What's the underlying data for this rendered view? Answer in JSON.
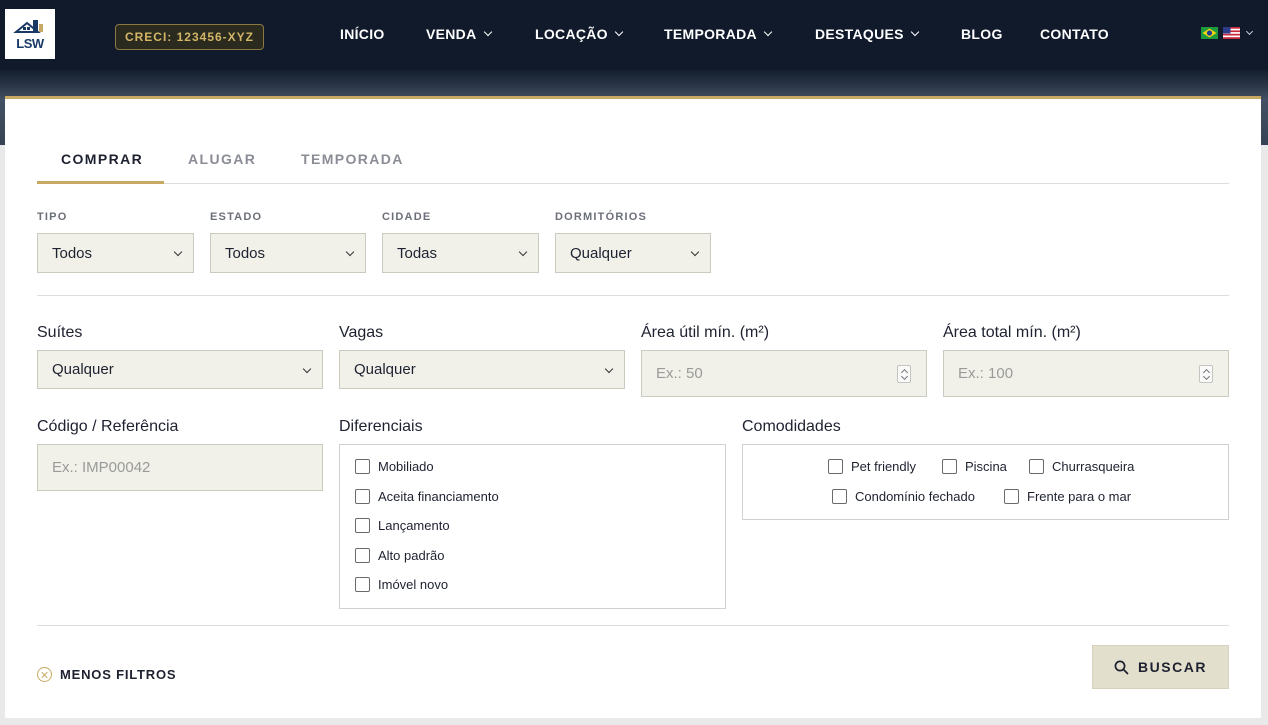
{
  "header": {
    "logo_text": "LSW",
    "creci": "CRECI: 123456-XYZ",
    "menu": [
      {
        "label": "INÍCIO",
        "dropdown": false
      },
      {
        "label": "VENDA",
        "dropdown": true
      },
      {
        "label": "LOCAÇÃO",
        "dropdown": true
      },
      {
        "label": "TEMPORADA",
        "dropdown": true
      },
      {
        "label": "DESTAQUES",
        "dropdown": true
      },
      {
        "label": "BLOG",
        "dropdown": false
      },
      {
        "label": "CONTATO",
        "dropdown": false
      }
    ],
    "languages": [
      "pt-BR flag",
      "en-US flag"
    ]
  },
  "search": {
    "tabs": [
      {
        "label": "COMPRAR",
        "active": true
      },
      {
        "label": "ALUGAR",
        "active": false
      },
      {
        "label": "TEMPORADA",
        "active": false
      }
    ],
    "quick_filters": [
      {
        "label": "TIPO",
        "value": "Todos"
      },
      {
        "label": "ESTADO",
        "value": "Todos"
      },
      {
        "label": "CIDADE",
        "value": "Todas"
      },
      {
        "label": "DORMITÓRIOS",
        "value": "Qualquer"
      }
    ],
    "advanced": {
      "suites": {
        "label": "Suítes",
        "value": "Qualquer"
      },
      "vagas": {
        "label": "Vagas",
        "value": "Qualquer"
      },
      "area_util": {
        "label": "Área útil mín. (m²)",
        "placeholder": "Ex.: 50"
      },
      "area_total": {
        "label": "Área total mín. (m²)",
        "placeholder": "Ex.: 100"
      },
      "codigo": {
        "label": "Código / Referência",
        "placeholder": "Ex.: IMP00042"
      },
      "diferenciais": {
        "label": "Diferenciais",
        "options": [
          "Mobiliado",
          "Aceita financiamento",
          "Lançamento",
          "Alto padrão",
          "Imóvel novo"
        ]
      },
      "comodidades": {
        "label": "Comodidades",
        "options": [
          "Pet friendly",
          "Piscina",
          "Churrasqueira",
          "Condomínio fechado",
          "Frente para o mar"
        ]
      }
    },
    "less_filters_label": "MENOS FILTROS",
    "submit_label": "BUSCAR"
  },
  "colors": {
    "accent_gold": "#c8a962",
    "nav_bg": "#101a2b",
    "field_bg": "#f1f1ea",
    "button_bg": "#e3dfcd"
  }
}
